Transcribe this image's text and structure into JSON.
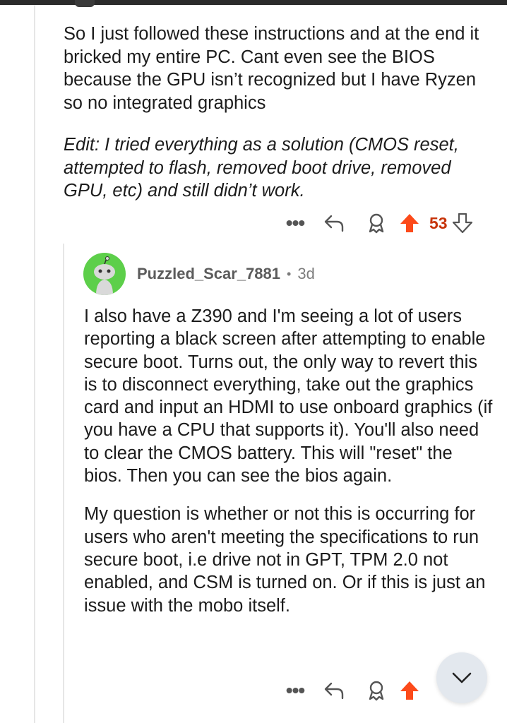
{
  "comment": {
    "body": "So I just followed these instructions and at the end it bricked my entire PC. Cant even see the BIOS because the GPU isn’t recognized but I have Ryzen so no integrated graphics",
    "edit": "Edit: I tried everything as a solution (CMOS reset, attempted to flash, removed boot drive, removed GPU, etc) and still didn’t work.",
    "actions": {
      "more": "•••",
      "upvotes": "53"
    }
  },
  "reply": {
    "username": "Puzzled_Scar_7881",
    "separator": "•",
    "age": "3d",
    "paragraph1": "I also have a Z390 and I'm seeing a lot of users reporting a black screen after attempting to enable secure boot. Turns out, the only way to revert this is to disconnect everything, take out the graphics card and input an HDMI to use onboard graphics (if you have a CPU that supports it). You'll also need to clear the CMOS battery. This will \"reset\" the bios. Then you can see the bios again.",
    "paragraph2": "My question is whether or not this is occurring for users who aren't meeting the specifications to run secure boot, i.e drive not in GPT, TPM 2.0 not enabled, and CSM is turned on. Or if this is just an issue with the mobo itself.",
    "actions": {
      "more": "•••"
    }
  },
  "colors": {
    "upvote": "#fc4a1a",
    "vote_count": "#c7340a",
    "avatar": "#5dcf4a",
    "fab_bg": "#e3e8ee"
  },
  "icons": [
    "more-icon",
    "reply-icon",
    "award-icon",
    "upvote-icon",
    "downvote-icon",
    "chevron-down-icon"
  ]
}
